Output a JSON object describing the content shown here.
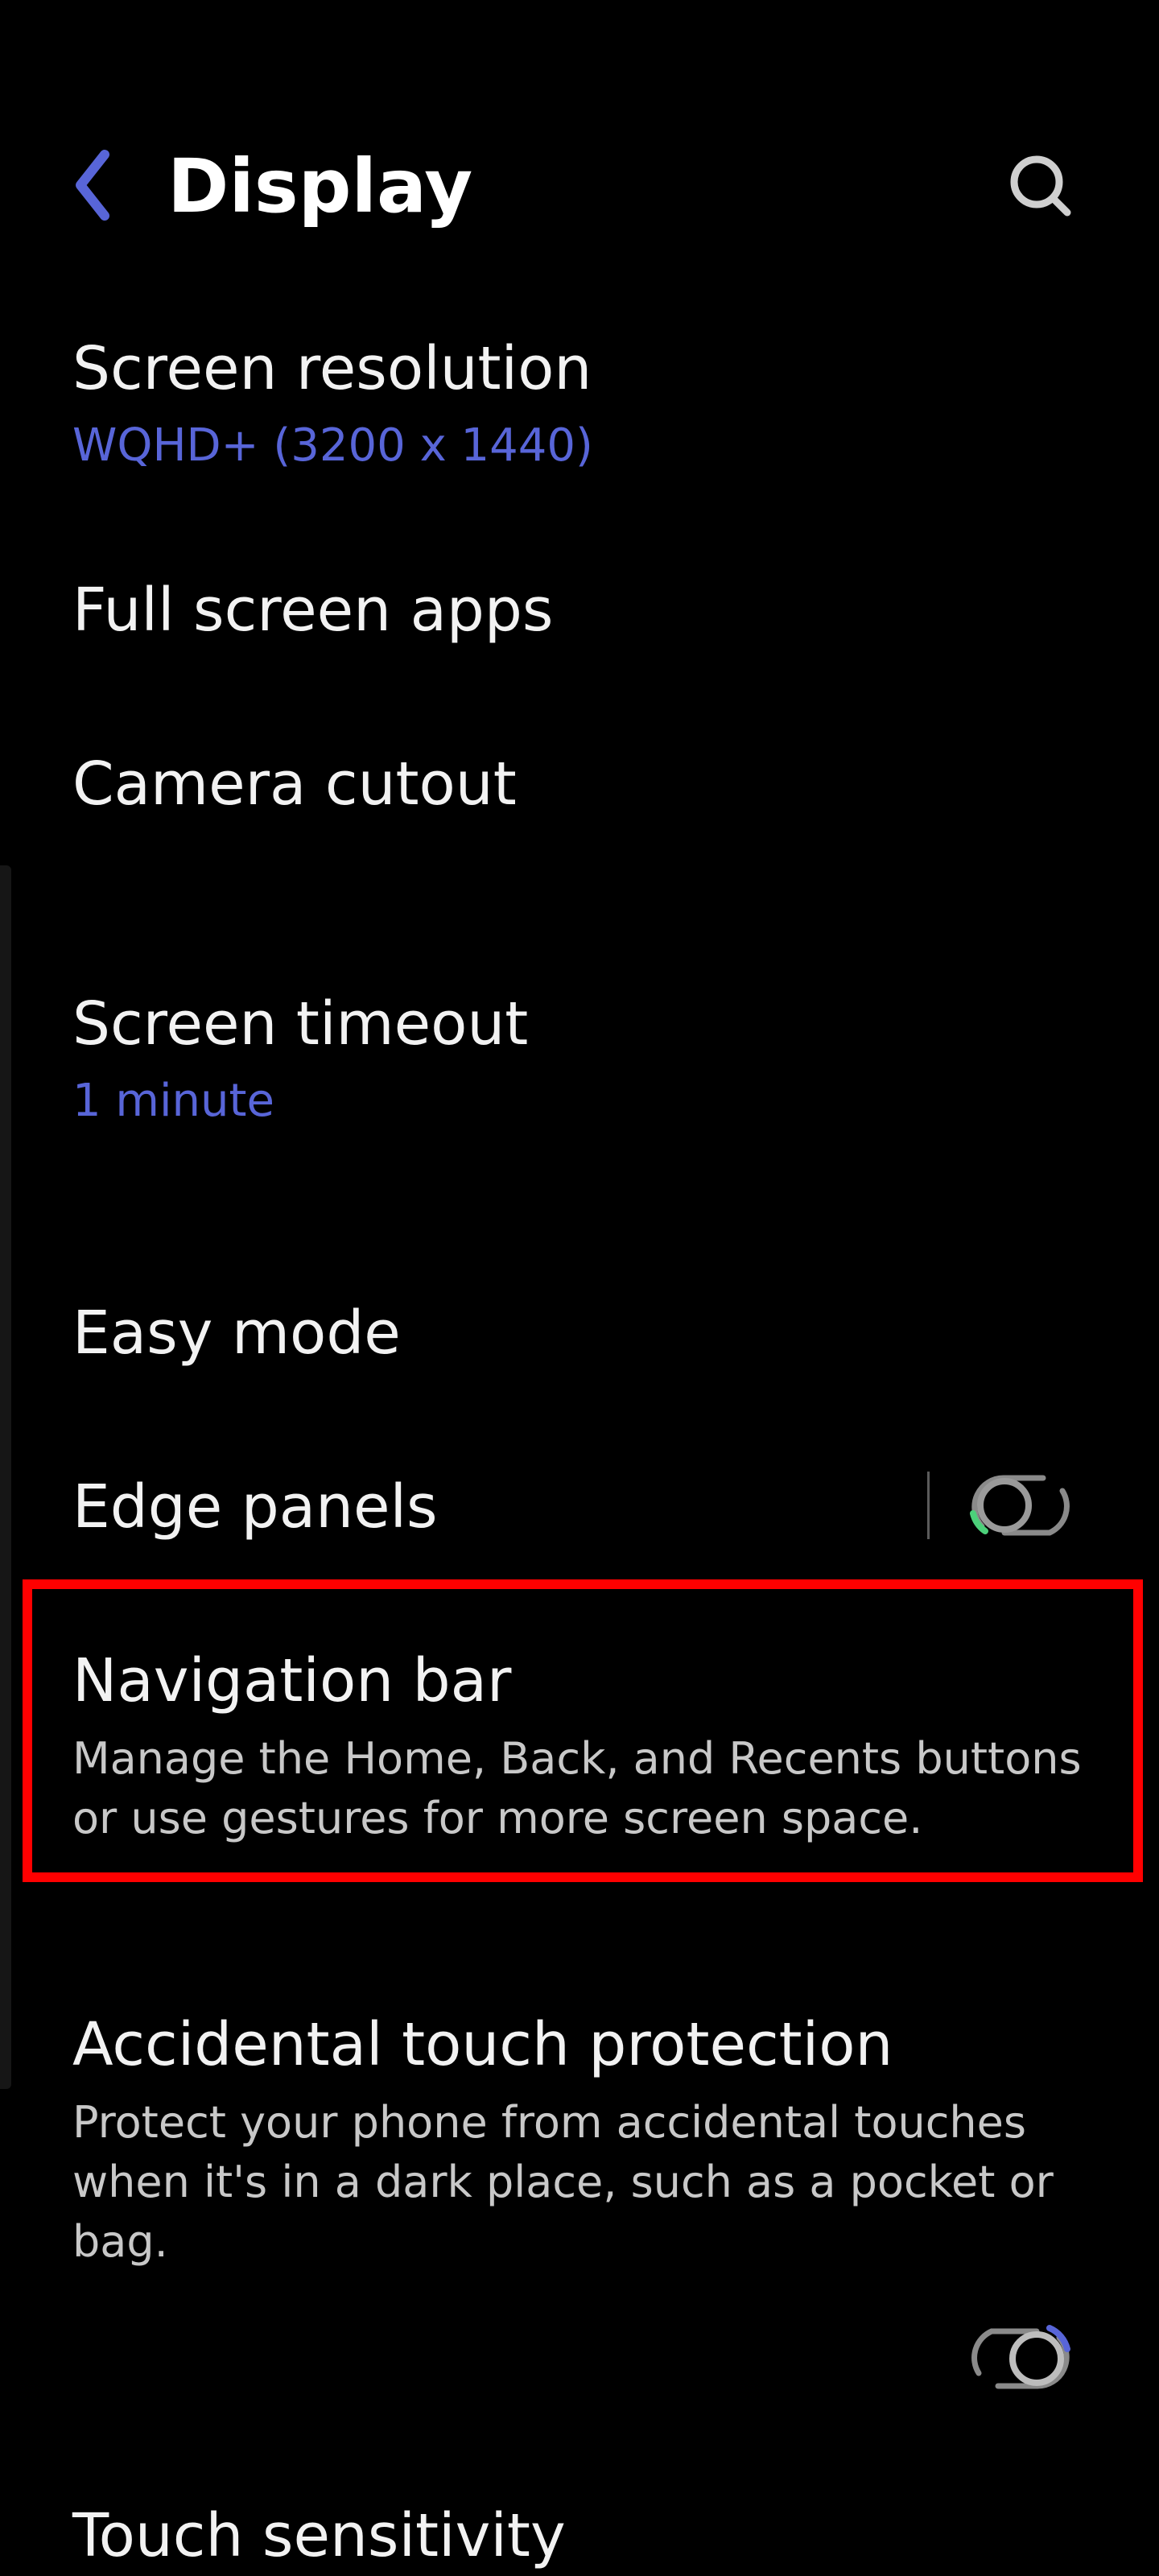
{
  "header": {
    "title": "Display",
    "back_icon": "back-arrow-icon",
    "search_icon": "search-icon",
    "accent_color": "#5865d8"
  },
  "settings": {
    "screen_resolution": {
      "title": "Screen resolution",
      "value": "WQHD+ (3200 x 1440)"
    },
    "full_screen_apps": {
      "title": "Full screen apps"
    },
    "camera_cutout": {
      "title": "Camera cutout"
    },
    "screen_timeout": {
      "title": "Screen timeout",
      "value": "1 minute"
    },
    "easy_mode": {
      "title": "Easy mode"
    },
    "edge_panels": {
      "title": "Edge panels",
      "toggle_on": false
    },
    "navigation_bar": {
      "title": "Navigation bar",
      "description": "Manage the Home, Back, and Recents buttons or use gestures for more screen space.",
      "highlighted": true,
      "highlight_color": "#ff0000"
    },
    "accidental_touch_protection": {
      "title": "Accidental touch protection",
      "description": "Protect your phone from accidental touches when it's in a dark place, such as a pocket or bag.",
      "toggle_on": false
    },
    "touch_sensitivity": {
      "title": "Touch sensitivity"
    }
  }
}
